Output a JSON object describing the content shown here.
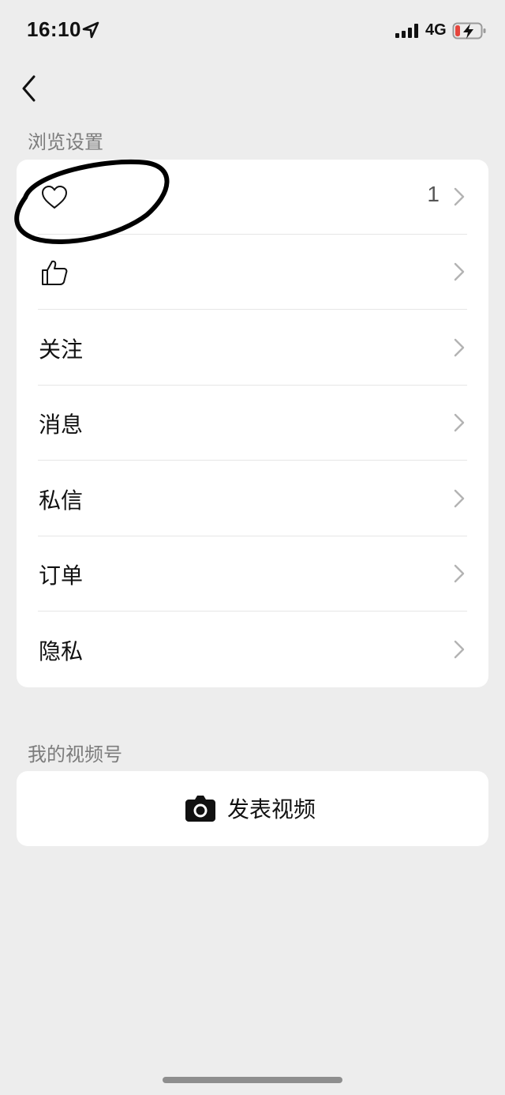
{
  "status_bar": {
    "time": "16:10",
    "network": "4G",
    "location_icon": "location-arrow-icon",
    "signal_icon": "cellular-signal-icon",
    "battery_icon": "battery-charging-icon"
  },
  "nav": {
    "back_icon": "chevron-left-icon"
  },
  "browse_section": {
    "title": "浏览设置",
    "items": [
      {
        "icon": "heart-icon",
        "label": "",
        "count": "1"
      },
      {
        "icon": "thumbs-up-icon",
        "label": ""
      },
      {
        "label": "关注"
      },
      {
        "label": "消息"
      },
      {
        "label": "私信"
      },
      {
        "label": "订单"
      },
      {
        "label": "隐私"
      }
    ]
  },
  "channels_section": {
    "title": "我的视频号",
    "publish_label": "发表视频",
    "publish_icon": "camera-icon"
  },
  "colors": {
    "background": "#ededed",
    "card": "#ffffff",
    "section_label": "#7c7c7c",
    "divider": "#e6e6e6",
    "chevron": "#b3b3b3",
    "battery_low": "#e5453c"
  }
}
